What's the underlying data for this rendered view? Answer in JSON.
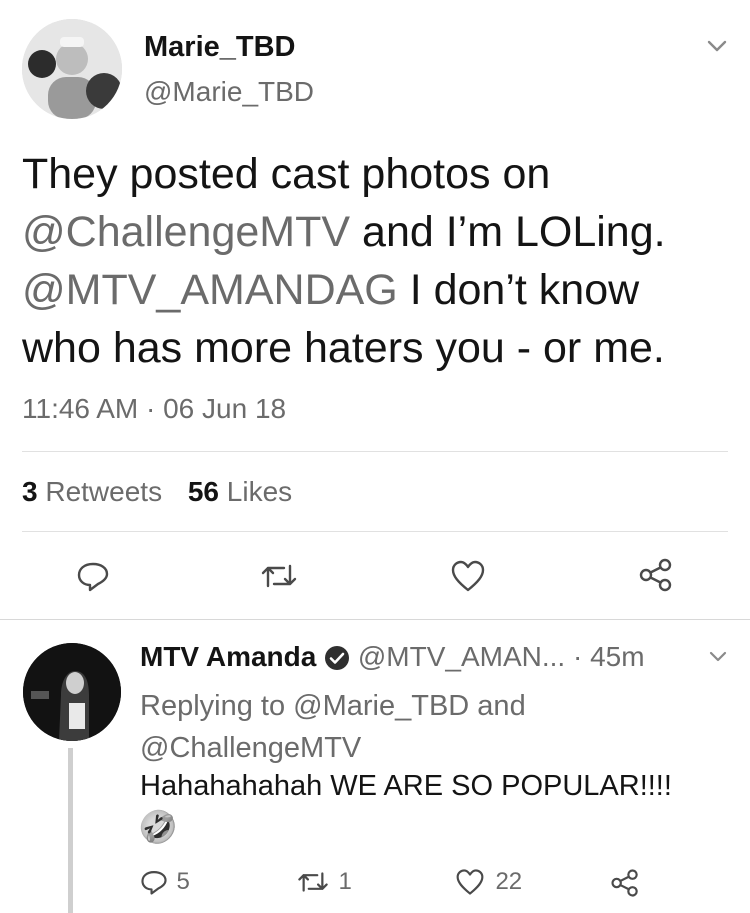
{
  "main_tweet": {
    "display_name": "Marie_TBD",
    "handle": "@Marie_TBD",
    "text_line1": "They posted cast photos on",
    "mention1": "@ChallengeMTV",
    "text_line2_rest": " and I’m LOLing.",
    "mention2": "@MTV_AMANDAG",
    "text_line3_rest": " I don’t know",
    "text_line4": "who has more haters you - or me.",
    "timestamp": "11:46 AM · 06 Jun 18",
    "retweets_count": "3",
    "retweets_label": "Retweets",
    "likes_count": "56",
    "likes_label": "Likes",
    "icons": [
      "reply-icon",
      "retweet-icon",
      "like-icon",
      "share-icon",
      "chevron-down-icon"
    ]
  },
  "reply_tweet": {
    "display_name": "MTV Amanda",
    "handle_time": "@MTV_AMAN... · 45m",
    "replying_prefix": "Replying to ",
    "replying_user1": "@Marie_TBD",
    "replying_and": " and",
    "replying_user2": "@ChallengeMTV",
    "text": "Hahahahahah WE ARE SO POPULAR!!!!",
    "emoji": "🤣",
    "reply_count": "5",
    "retweet_count": "1",
    "like_count": "22",
    "icons": [
      "reply-icon",
      "retweet-icon",
      "like-icon",
      "share-icon",
      "verified-icon",
      "chevron-down-icon"
    ]
  }
}
